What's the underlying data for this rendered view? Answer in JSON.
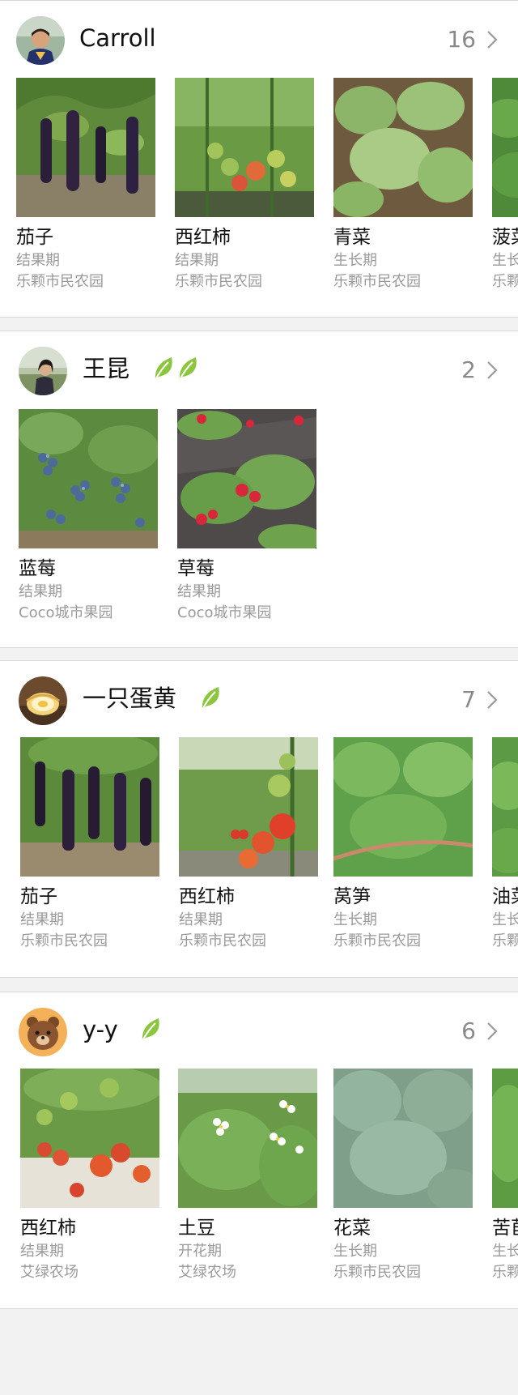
{
  "colors": {
    "leaf_green": "#8cc63f",
    "muted_text": "#9a9a9a",
    "primary_text": "#111111",
    "background": "#f2f2f2",
    "card": "#ffffff"
  },
  "users": [
    {
      "name": "Carroll",
      "leaf_badges": 0,
      "count": "16",
      "plants": [
        {
          "name": "茄子",
          "stage": "结果期",
          "farm": "乐颗市民农园",
          "photo": "eggplant"
        },
        {
          "name": "西红柿",
          "stage": "结果期",
          "farm": "乐颗市民农园",
          "photo": "tomato"
        },
        {
          "name": "青菜",
          "stage": "生长期",
          "farm": "乐颗市民农园",
          "photo": "greens"
        },
        {
          "name": "菠菜",
          "stage": "生长期",
          "farm": "乐颗市民农园",
          "photo": "spinach"
        }
      ]
    },
    {
      "name": "王昆",
      "leaf_badges": 2,
      "count": "2",
      "plants": [
        {
          "name": "蓝莓",
          "stage": "结果期",
          "farm": "Coco城市果园",
          "photo": "blueberry"
        },
        {
          "name": "草莓",
          "stage": "结果期",
          "farm": "Coco城市果园",
          "photo": "strawberry"
        }
      ]
    },
    {
      "name": "一只蛋黄",
      "leaf_badges": 1,
      "count": "7",
      "plants": [
        {
          "name": "茄子",
          "stage": "结果期",
          "farm": "乐颗市民农园",
          "photo": "eggplant"
        },
        {
          "name": "西红柿",
          "stage": "结果期",
          "farm": "乐颗市民农园",
          "photo": "tomato"
        },
        {
          "name": "莴笋",
          "stage": "生长期",
          "farm": "乐颗市民农园",
          "photo": "lettuce"
        },
        {
          "name": "油菜",
          "stage": "生长期",
          "farm": "乐颗市民农园",
          "photo": "greens"
        }
      ]
    },
    {
      "name": "y-y",
      "leaf_badges": 1,
      "count": "6",
      "plants": [
        {
          "name": "西红柿",
          "stage": "结果期",
          "farm": "艾绿农场",
          "photo": "tomato"
        },
        {
          "name": "土豆",
          "stage": "开花期",
          "farm": "艾绿农场",
          "photo": "potato"
        },
        {
          "name": "花菜",
          "stage": "生长期",
          "farm": "乐颗市民农园",
          "photo": "cauliflower"
        },
        {
          "name": "苦苣",
          "stage": "生长期",
          "farm": "乐颗市民农园",
          "photo": "endive"
        }
      ]
    }
  ]
}
